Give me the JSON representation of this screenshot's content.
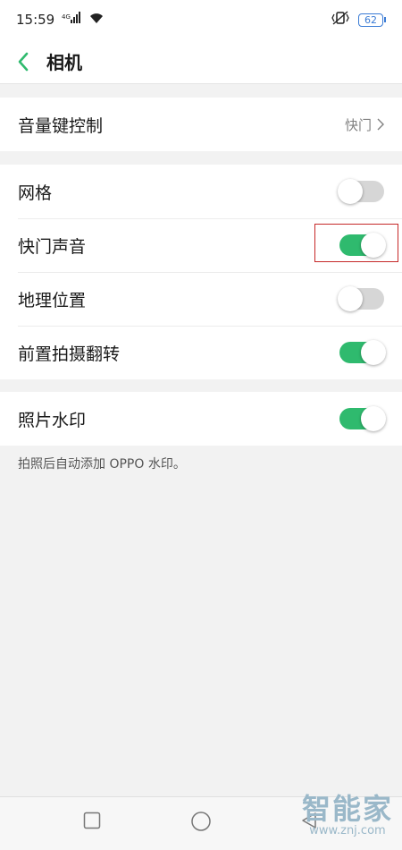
{
  "status_bar": {
    "time": "15:59",
    "signal_icon": "signal-icon",
    "wifi_icon": "wifi-icon",
    "vibrate_icon": "vibrate-icon",
    "battery_level": "62"
  },
  "header": {
    "title": "相机",
    "back_icon": "back-icon",
    "accent_color": "#2fba6e"
  },
  "volume_key": {
    "label": "音量键控制",
    "value": "快门"
  },
  "toggles": [
    {
      "label": "网格",
      "on": false
    },
    {
      "label": "快门声音",
      "on": true
    },
    {
      "label": "地理位置",
      "on": false
    },
    {
      "label": "前置拍摄翻转",
      "on": true
    }
  ],
  "watermark_setting": {
    "label": "照片水印",
    "on": true,
    "description": "拍照后自动添加 OPPO 水印。"
  },
  "nav_bar": {
    "recents_icon": "square-icon",
    "home_icon": "circle-icon",
    "back_icon": "triangle-icon"
  },
  "site_watermark": {
    "name": "智能家",
    "url": "www.znj.com"
  }
}
